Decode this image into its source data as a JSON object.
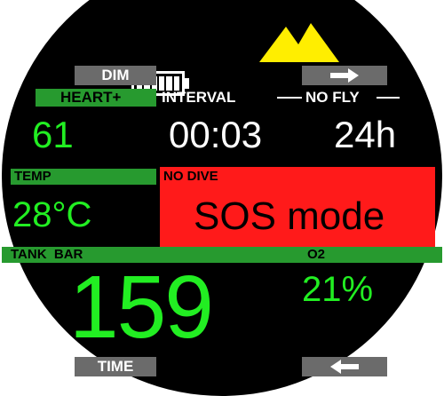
{
  "colors": {
    "background": "#000000",
    "label_bar": "#279a2f",
    "value_green": "#22ee22",
    "alert_red": "#ff1a1a",
    "button_gray": "#6b6b6b",
    "altitude_yellow": "#ffee00"
  },
  "icons": {
    "battery": "battery-icon",
    "altitude": "mountain-icon",
    "arrow_right": "arrow-right-icon",
    "arrow_left": "arrow-left-icon"
  },
  "battery_level": 1.0,
  "buttons": {
    "top_left": "DIM",
    "bottom_left": "TIME"
  },
  "heart": {
    "label": "HEART+",
    "value": "61"
  },
  "interval": {
    "label": "INTERVAL",
    "value": "00:03"
  },
  "nofly": {
    "label": "NO FLY",
    "value": "24h"
  },
  "temp": {
    "label": "TEMP",
    "value": "28°C"
  },
  "alert": {
    "label": "NO DIVE",
    "value": "SOS mode"
  },
  "tank": {
    "label": "TANK  BAR",
    "value": "159"
  },
  "o2": {
    "label": "O2",
    "value": "21%"
  }
}
